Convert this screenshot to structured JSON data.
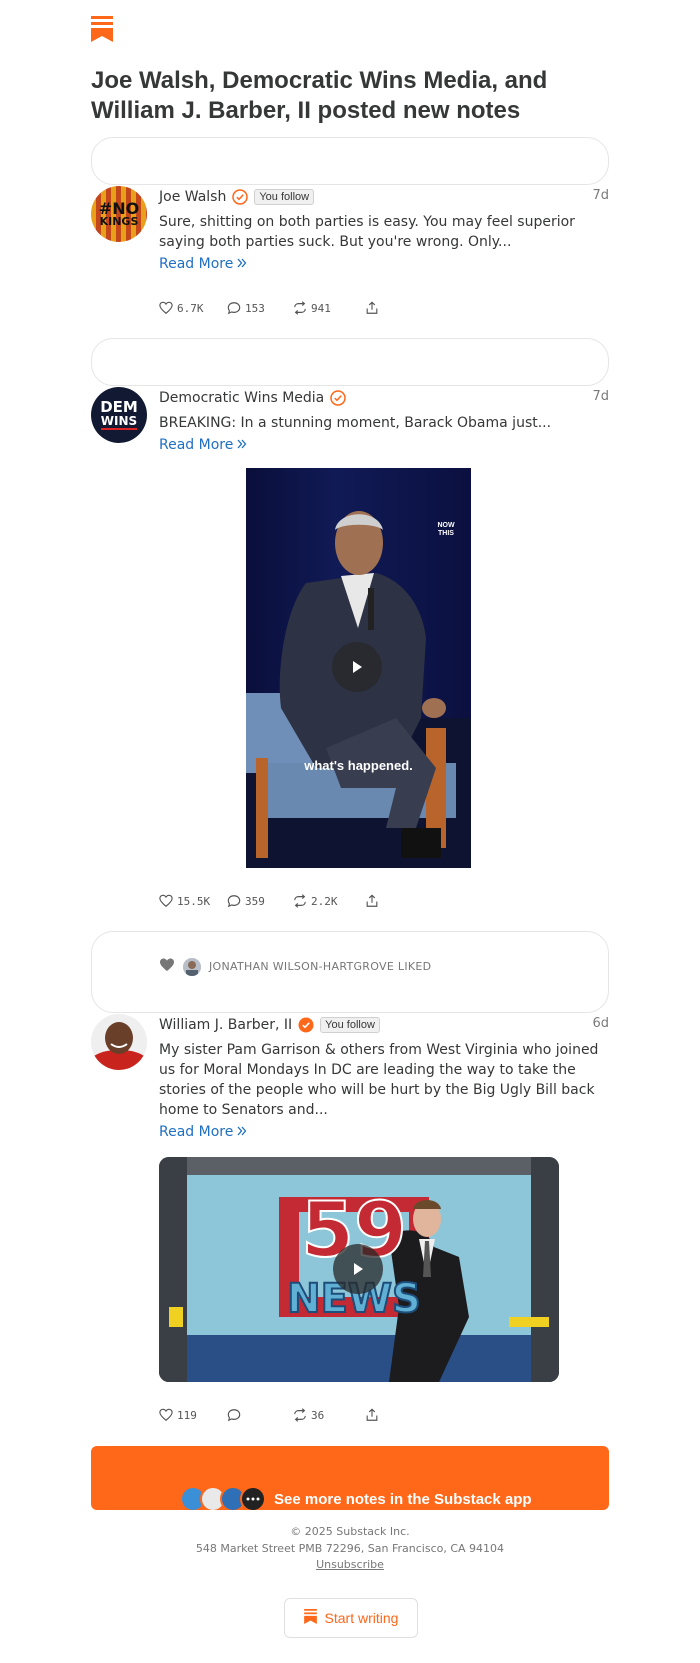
{
  "headline": "Joe Walsh, Democratic Wins Media, and William J. Barber, II posted new notes",
  "colors": {
    "brand": "#ff6719",
    "link": "#1f6fc3",
    "text": "#363737"
  },
  "notes": [
    {
      "author": "Joe Walsh",
      "badge": "You follow",
      "time": "7d",
      "text": "Sure, shitting on both parties is easy. You may feel superior saying both parties suck. But you're wrong. Only...",
      "read_more": "Read More",
      "avatar_text_1": "#NO",
      "avatar_text_2": "KINGS",
      "likes": "6.7K",
      "comments": "153",
      "restacks": "941"
    },
    {
      "author": "Democratic Wins Media",
      "time": "7d",
      "text": "BREAKING: In a stunning moment, Barack Obama just...",
      "read_more": "Read More",
      "avatar_text_1": "DEM",
      "avatar_text_2": "WINS",
      "video_caption": "what's happened.",
      "video_watermark": "NOW THIS",
      "likes": "15.5K",
      "comments": "359",
      "restacks": "2.2K"
    },
    {
      "liked_by": "JONATHAN WILSON-HARTGROVE LIKED",
      "author": "William J. Barber, II",
      "badge": "You follow",
      "time": "6d",
      "text": "My sister Pam Garrison & others from West Virginia who joined us for Moral Mondays In DC are leading the way to take the stories of the people who will be hurt by the Big Ugly Bill back home to Senators and...",
      "read_more": "Read More",
      "video_logo_number": "59",
      "video_logo_word": "NEWS",
      "likes": "119",
      "comments": "",
      "restacks": "36"
    }
  ],
  "cta": {
    "label": "See more notes in the Substack app"
  },
  "footer": {
    "copyright": "© 2025 Substack Inc.",
    "address": "548 Market Street PMB 72296, San Francisco, CA 94104",
    "unsubscribe": "Unsubscribe"
  },
  "start_writing": "Start writing",
  "icons": [
    "substack-logo-icon",
    "verified-icon",
    "heart-icon",
    "comment-icon",
    "restack-icon",
    "share-icon",
    "play-icon",
    "chevrons-right-icon"
  ]
}
